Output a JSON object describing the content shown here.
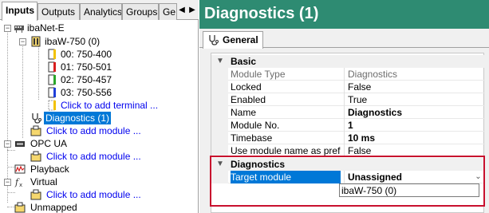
{
  "left_panel": {
    "tabs": [
      {
        "label": "Inputs",
        "active": true
      },
      {
        "label": "Outputs",
        "active": false
      },
      {
        "label": "Analytics",
        "active": false
      },
      {
        "label": "Groups",
        "active": false
      },
      {
        "label": "Ge",
        "active": false
      }
    ],
    "tab_scroll": {
      "left": "◀",
      "right": "▶"
    },
    "tree": {
      "root": "ibaNet-E",
      "device": "ibaW-750 (0)",
      "terminals": [
        "00: 750-400",
        "01: 750-501",
        "02: 750-457",
        "03: 750-556"
      ],
      "add_terminal": "Click to add terminal ...",
      "diagnostics": "Diagnostics (1)",
      "add_module_1": "Click to add module ...",
      "opc_ua": "OPC UA",
      "add_module_2": "Click to add module ...",
      "playback": "Playback",
      "virtual": "Virtual",
      "add_module_3": "Click to add module ...",
      "unmapped": "Unmapped",
      "terminal_colors": [
        "#f2c200",
        "#d81e1e",
        "#2aa62a",
        "#1f3fd8"
      ]
    }
  },
  "right_panel": {
    "title": "Diagnostics (1)",
    "tab": "General",
    "categories": {
      "basic": "Basic",
      "diagnostics": "Diagnostics"
    },
    "basic_rows": [
      {
        "name": "Module Type",
        "value": "Diagnostics",
        "readonly": true,
        "bold": false
      },
      {
        "name": "Locked",
        "value": "False",
        "readonly": false,
        "bold": false
      },
      {
        "name": "Enabled",
        "value": "True",
        "readonly": false,
        "bold": false
      },
      {
        "name": "Name",
        "value": "Diagnostics",
        "readonly": false,
        "bold": true
      },
      {
        "name": "Module No.",
        "value": "1",
        "readonly": false,
        "bold": true
      },
      {
        "name": "Timebase",
        "value": "10 ms",
        "readonly": false,
        "bold": true
      },
      {
        "name": "Use module name as prefix",
        "value": "False",
        "readonly": false,
        "bold": false
      }
    ],
    "diagnostics_rows": [
      {
        "name": "Target module",
        "value": "Unassigned",
        "bold": true
      }
    ],
    "dropdown_option": "ibaW-750 (0)"
  },
  "colors": {
    "header_bg": "#2e8b72",
    "selection": "#0078d7",
    "highlight_border": "#c8102e",
    "link": "#0000ee"
  }
}
